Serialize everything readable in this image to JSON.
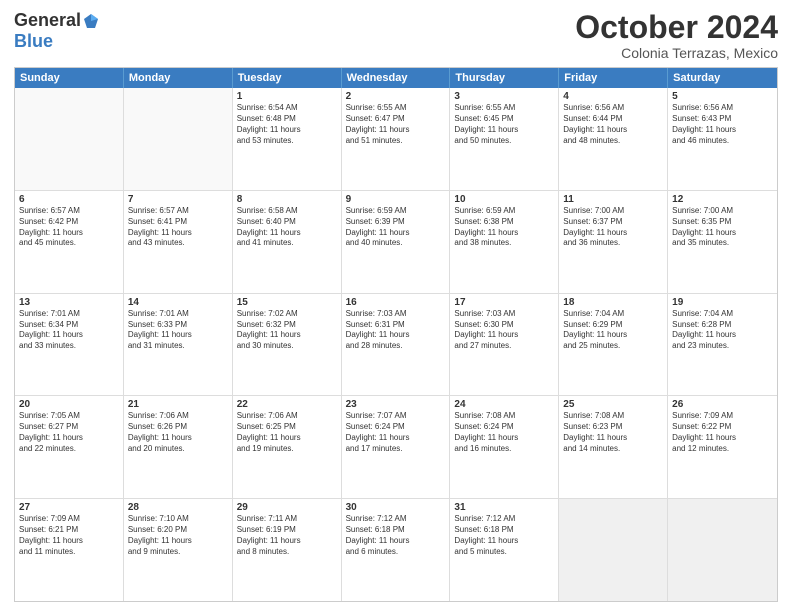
{
  "logo": {
    "general": "General",
    "blue": "Blue"
  },
  "title": "October 2024",
  "location": "Colonia Terrazas, Mexico",
  "header_days": [
    "Sunday",
    "Monday",
    "Tuesday",
    "Wednesday",
    "Thursday",
    "Friday",
    "Saturday"
  ],
  "weeks": [
    [
      {
        "day": "",
        "info": ""
      },
      {
        "day": "",
        "info": ""
      },
      {
        "day": "1",
        "info": "Sunrise: 6:54 AM\nSunset: 6:48 PM\nDaylight: 11 hours\nand 53 minutes."
      },
      {
        "day": "2",
        "info": "Sunrise: 6:55 AM\nSunset: 6:47 PM\nDaylight: 11 hours\nand 51 minutes."
      },
      {
        "day": "3",
        "info": "Sunrise: 6:55 AM\nSunset: 6:45 PM\nDaylight: 11 hours\nand 50 minutes."
      },
      {
        "day": "4",
        "info": "Sunrise: 6:56 AM\nSunset: 6:44 PM\nDaylight: 11 hours\nand 48 minutes."
      },
      {
        "day": "5",
        "info": "Sunrise: 6:56 AM\nSunset: 6:43 PM\nDaylight: 11 hours\nand 46 minutes."
      }
    ],
    [
      {
        "day": "6",
        "info": "Sunrise: 6:57 AM\nSunset: 6:42 PM\nDaylight: 11 hours\nand 45 minutes."
      },
      {
        "day": "7",
        "info": "Sunrise: 6:57 AM\nSunset: 6:41 PM\nDaylight: 11 hours\nand 43 minutes."
      },
      {
        "day": "8",
        "info": "Sunrise: 6:58 AM\nSunset: 6:40 PM\nDaylight: 11 hours\nand 41 minutes."
      },
      {
        "day": "9",
        "info": "Sunrise: 6:59 AM\nSunset: 6:39 PM\nDaylight: 11 hours\nand 40 minutes."
      },
      {
        "day": "10",
        "info": "Sunrise: 6:59 AM\nSunset: 6:38 PM\nDaylight: 11 hours\nand 38 minutes."
      },
      {
        "day": "11",
        "info": "Sunrise: 7:00 AM\nSunset: 6:37 PM\nDaylight: 11 hours\nand 36 minutes."
      },
      {
        "day": "12",
        "info": "Sunrise: 7:00 AM\nSunset: 6:35 PM\nDaylight: 11 hours\nand 35 minutes."
      }
    ],
    [
      {
        "day": "13",
        "info": "Sunrise: 7:01 AM\nSunset: 6:34 PM\nDaylight: 11 hours\nand 33 minutes."
      },
      {
        "day": "14",
        "info": "Sunrise: 7:01 AM\nSunset: 6:33 PM\nDaylight: 11 hours\nand 31 minutes."
      },
      {
        "day": "15",
        "info": "Sunrise: 7:02 AM\nSunset: 6:32 PM\nDaylight: 11 hours\nand 30 minutes."
      },
      {
        "day": "16",
        "info": "Sunrise: 7:03 AM\nSunset: 6:31 PM\nDaylight: 11 hours\nand 28 minutes."
      },
      {
        "day": "17",
        "info": "Sunrise: 7:03 AM\nSunset: 6:30 PM\nDaylight: 11 hours\nand 27 minutes."
      },
      {
        "day": "18",
        "info": "Sunrise: 7:04 AM\nSunset: 6:29 PM\nDaylight: 11 hours\nand 25 minutes."
      },
      {
        "day": "19",
        "info": "Sunrise: 7:04 AM\nSunset: 6:28 PM\nDaylight: 11 hours\nand 23 minutes."
      }
    ],
    [
      {
        "day": "20",
        "info": "Sunrise: 7:05 AM\nSunset: 6:27 PM\nDaylight: 11 hours\nand 22 minutes."
      },
      {
        "day": "21",
        "info": "Sunrise: 7:06 AM\nSunset: 6:26 PM\nDaylight: 11 hours\nand 20 minutes."
      },
      {
        "day": "22",
        "info": "Sunrise: 7:06 AM\nSunset: 6:25 PM\nDaylight: 11 hours\nand 19 minutes."
      },
      {
        "day": "23",
        "info": "Sunrise: 7:07 AM\nSunset: 6:24 PM\nDaylight: 11 hours\nand 17 minutes."
      },
      {
        "day": "24",
        "info": "Sunrise: 7:08 AM\nSunset: 6:24 PM\nDaylight: 11 hours\nand 16 minutes."
      },
      {
        "day": "25",
        "info": "Sunrise: 7:08 AM\nSunset: 6:23 PM\nDaylight: 11 hours\nand 14 minutes."
      },
      {
        "day": "26",
        "info": "Sunrise: 7:09 AM\nSunset: 6:22 PM\nDaylight: 11 hours\nand 12 minutes."
      }
    ],
    [
      {
        "day": "27",
        "info": "Sunrise: 7:09 AM\nSunset: 6:21 PM\nDaylight: 11 hours\nand 11 minutes."
      },
      {
        "day": "28",
        "info": "Sunrise: 7:10 AM\nSunset: 6:20 PM\nDaylight: 11 hours\nand 9 minutes."
      },
      {
        "day": "29",
        "info": "Sunrise: 7:11 AM\nSunset: 6:19 PM\nDaylight: 11 hours\nand 8 minutes."
      },
      {
        "day": "30",
        "info": "Sunrise: 7:12 AM\nSunset: 6:18 PM\nDaylight: 11 hours\nand 6 minutes."
      },
      {
        "day": "31",
        "info": "Sunrise: 7:12 AM\nSunset: 6:18 PM\nDaylight: 11 hours\nand 5 minutes."
      },
      {
        "day": "",
        "info": ""
      },
      {
        "day": "",
        "info": ""
      }
    ]
  ]
}
